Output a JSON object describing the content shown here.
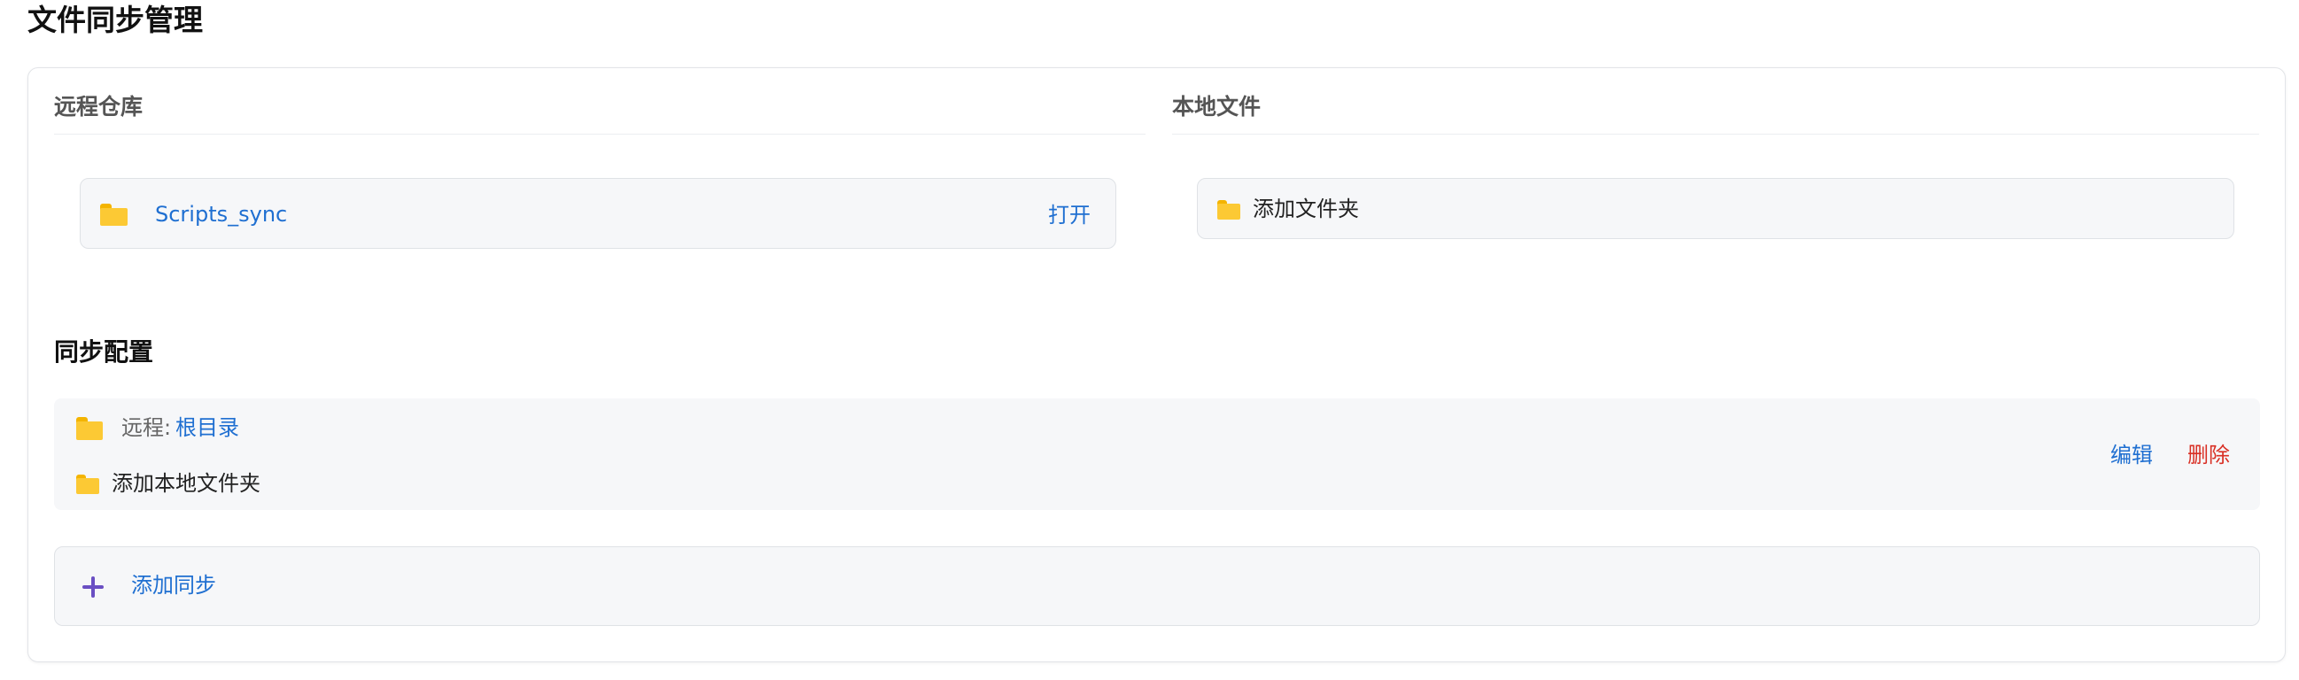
{
  "page": {
    "title": "文件同步管理"
  },
  "remote_section": {
    "heading": "远程仓库",
    "repo": {
      "name": "Scripts_sync",
      "open_label": "打开",
      "icon": "folder-icon"
    }
  },
  "local_section": {
    "heading": "本地文件",
    "add_folder_label": "添加文件夹",
    "icon": "folder-icon"
  },
  "sync_config": {
    "heading": "同步配置",
    "items": [
      {
        "remote_prefix": "远程:",
        "remote_path": "根目录",
        "add_local_label": "添加本地文件夹",
        "edit_label": "编辑",
        "delete_label": "删除"
      }
    ],
    "add_sync_label": "添加同步",
    "add_icon": "plus-icon"
  },
  "colors": {
    "link": "#1f6fd1",
    "danger": "#d93025",
    "folder": "#fcc934",
    "plus": "#6a4fc3"
  }
}
